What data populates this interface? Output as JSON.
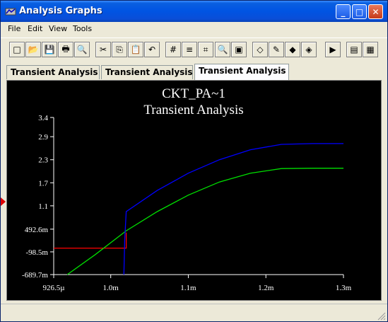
{
  "window": {
    "title": "Analysis Graphs"
  },
  "menu": [
    "File",
    "Edit",
    "View",
    "Tools"
  ],
  "toolbar": {
    "buttons": [
      {
        "name": "new-icon",
        "glyph": "□"
      },
      {
        "name": "open-icon",
        "glyph": "📂"
      },
      {
        "name": "save-icon",
        "glyph": "💾"
      },
      {
        "name": "print-icon",
        "glyph": "🖶"
      },
      {
        "name": "print-preview-icon",
        "glyph": "🔍"
      },
      {
        "name": "cut-icon",
        "glyph": "✂"
      },
      {
        "name": "copy-icon",
        "glyph": "⎘"
      },
      {
        "name": "paste-icon",
        "glyph": "📋"
      },
      {
        "name": "undo-icon",
        "glyph": "↶"
      },
      {
        "name": "grid-icon",
        "glyph": "#"
      },
      {
        "name": "legend-icon",
        "glyph": "≡"
      },
      {
        "name": "cursors-icon",
        "glyph": "⌗"
      },
      {
        "name": "zoom-icon",
        "glyph": "🔍"
      },
      {
        "name": "overlay-icon",
        "glyph": "▣"
      },
      {
        "name": "select-trace-icon",
        "glyph": "◇"
      },
      {
        "name": "properties-icon",
        "glyph": "✎"
      },
      {
        "name": "color-icon",
        "glyph": "◆"
      },
      {
        "name": "export-icon",
        "glyph": "◈"
      },
      {
        "name": "export-excel-icon",
        "glyph": "▶"
      },
      {
        "name": "export-mathcad-icon",
        "glyph": "▤"
      },
      {
        "name": "export-chart-icon",
        "glyph": "▦"
      }
    ]
  },
  "tabs": [
    "Transient Analysis",
    "Transient Analysis",
    "Transient Analysis"
  ],
  "active_tab": 2,
  "colors": {
    "title_blue": "#0054e3",
    "trace_blue": "#0000ff",
    "trace_green": "#00e000",
    "trace_red": "#ff0000",
    "plot_bg": "#000000"
  },
  "chart_data": {
    "type": "line",
    "title": "CKT_PA~1",
    "subtitle": "Transient Analysis",
    "xlabel": "",
    "ylabel": "",
    "x_ticks": [
      "926.5µ",
      "1.0m",
      "1.1m",
      "1.2m",
      "1.3m"
    ],
    "x_tick_values": [
      0.0009265,
      0.001,
      0.0011,
      0.0012,
      0.0013
    ],
    "y_ticks": [
      "3.4",
      "2.9",
      "2.3",
      "1.7",
      "1.1",
      "492.6m",
      "-98.5m",
      "-689.7m"
    ],
    "y_tick_values": [
      3.4,
      2.9,
      2.3,
      1.7,
      1.1,
      0.4926,
      -0.0985,
      -0.6897
    ],
    "xlim": [
      0.0009265,
      0.0013
    ],
    "ylim": [
      -0.6897,
      3.4
    ],
    "series": [
      {
        "color": "#ff0000",
        "x": [
          0.0009265,
          0.00101,
          0.00102,
          0.00102
        ],
        "y": [
          0.0,
          0.0,
          0.0,
          0.4
        ]
      },
      {
        "color": "#00e000",
        "x": [
          0.000944,
          0.00098,
          0.00102,
          0.00106,
          0.0011,
          0.00114,
          0.00118,
          0.00122,
          0.00126,
          0.0013
        ],
        "y": [
          -0.69,
          -0.17,
          0.45,
          0.95,
          1.38,
          1.72,
          1.95,
          2.07,
          2.08,
          2.08
        ]
      },
      {
        "color": "#0000ff",
        "x": [
          0.001017,
          0.001018,
          0.00102,
          0.00106,
          0.0011,
          0.00114,
          0.00118,
          0.00122,
          0.00126,
          0.0013
        ],
        "y": [
          -0.69,
          0.2,
          0.95,
          1.5,
          1.95,
          2.3,
          2.56,
          2.7,
          2.72,
          2.72
        ]
      }
    ],
    "grid": false,
    "legend": "none"
  }
}
